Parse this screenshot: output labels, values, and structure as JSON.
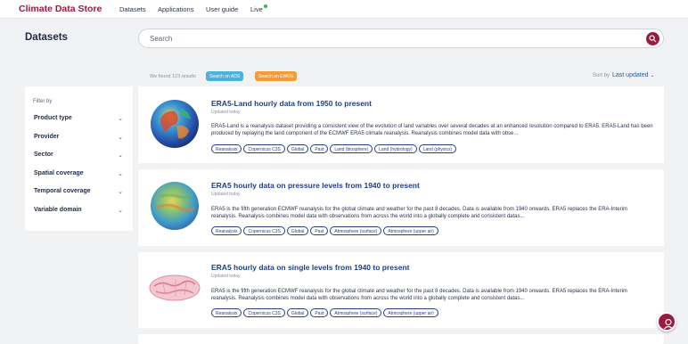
{
  "header": {
    "brand": "Climate Data Store",
    "nav": [
      "Datasets",
      "Applications",
      "User guide",
      "Live"
    ],
    "live_status_color": "#3cb44b"
  },
  "page": {
    "title": "Datasets"
  },
  "search": {
    "placeholder": "Search",
    "button_icon": "search-icon"
  },
  "results": {
    "count_text": "We found 123 results",
    "search_ads_label": "Search on ADS",
    "search_ewds_label": "Search on EWDS",
    "sort_label": "Sort by",
    "sort_value": "Last updated"
  },
  "filters": {
    "title": "Filter by",
    "items": [
      "Product type",
      "Provider",
      "Sector",
      "Spatial coverage",
      "Temporal coverage",
      "Variable domain"
    ]
  },
  "datasets": [
    {
      "title": "ERA5-Land hourly data from 1950 to present",
      "updated": "Updated today",
      "description": "ERA5-Land is a reanalysis dataset providing a consistent view of the evolution of land variables over several decades at an enhanced resolution compared to ERA5. ERA5-Land has been produced by replaying the land component of the ECMWF ERA5 climate reanalysis. Reanalysis combines model data with obse...",
      "tags": [
        "Reanalysis",
        "Copernicus C3S",
        "Global",
        "Past",
        "Land (biosphere)",
        "Land (hydrology)",
        "Land (physics)"
      ]
    },
    {
      "title": "ERA5 hourly data on pressure levels from 1940 to present",
      "updated": "Updated today",
      "description": "ERA5 is the fifth generation ECMWF reanalysis for the global climate and weather for the past 8 decades. Data is available from 1940 onwards. ERA5 replaces the ERA-Interim reanalysis. Reanalysis combines model data with observations from across the world into a globally complete and consistent datas...",
      "tags": [
        "Reanalysis",
        "Copernicus C3S",
        "Global",
        "Past",
        "Atmosphere (surface)",
        "Atmosphere (upper air)"
      ]
    },
    {
      "title": "ERA5 hourly data on single levels from 1940 to present",
      "updated": "Updated today",
      "description": "ERA5 is the fifth generation ECMWF reanalysis for the global climate and weather for the past 8 decades. Data is available from 1940 onwards. ERA5 replaces the ERA-Interim reanalysis. Reanalysis combines model data with observations from across the world into a globally complete and consistent datas...",
      "tags": [
        "Reanalysis",
        "Copernicus C3S",
        "Global",
        "Past",
        "Atmosphere (surface)",
        "Atmosphere (upper air)"
      ]
    }
  ],
  "chat": {
    "icon": "chat-assistant-icon"
  }
}
